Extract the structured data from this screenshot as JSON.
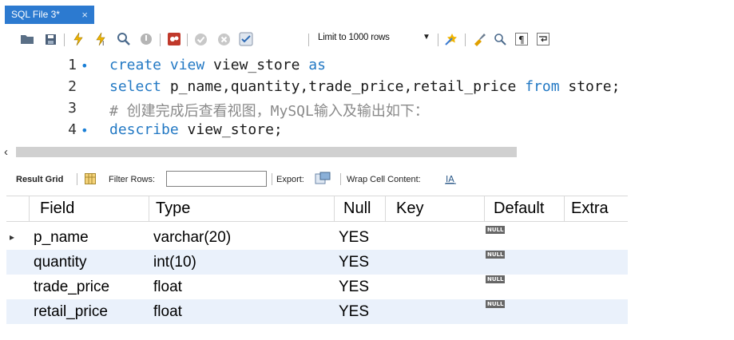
{
  "tab": {
    "title": "SQL File 3*",
    "close": "×"
  },
  "toolbar": {
    "limit_label": "Limit to 1000 rows",
    "icons": [
      "folder-icon",
      "save-icon",
      "execute-icon",
      "execute-current-icon",
      "explain-icon",
      "stop-icon",
      "toggle-error-icon",
      "commit-icon",
      "rollback-icon",
      "autocommit-icon",
      "beautify-icon",
      "find-icon",
      "invisible-chars-icon",
      "wrap-icon"
    ]
  },
  "editor": {
    "lines": [
      {
        "num": "1",
        "dot": "•"
      },
      {
        "num": "2",
        "dot": ""
      },
      {
        "num": "3",
        "dot": ""
      },
      {
        "num": "4",
        "dot": "•"
      }
    ],
    "line1": {
      "kw1": "create view",
      "id1": " view_store ",
      "kw2": "as"
    },
    "line2": {
      "kw1": "select",
      "id1": " p_name,quantity,trade_price,retail_price ",
      "kw2": "from",
      "id2": " store;"
    },
    "line3": {
      "comment": "# 创建完成后查看视图，MySQL输入及输出如下："
    },
    "line4": {
      "kw1": "describe",
      "id1": " view_store;"
    }
  },
  "scroll": {
    "left_arrow": "‹"
  },
  "result_toolbar": {
    "result_grid": "Result Grid",
    "filter_rows": "Filter Rows:",
    "export": "Export:",
    "wrap": "Wrap Cell Content:"
  },
  "grid": {
    "headers": [
      "Field",
      "Type",
      "Null",
      "Key",
      "Default",
      "Extra"
    ],
    "rows": [
      {
        "field": "p_name",
        "type": "varchar(20)",
        "null": "YES",
        "key": "",
        "default": "NULL",
        "extra": ""
      },
      {
        "field": "quantity",
        "type": "int(10)",
        "null": "YES",
        "key": "",
        "default": "NULL",
        "extra": ""
      },
      {
        "field": "trade_price",
        "type": "float",
        "null": "YES",
        "key": "",
        "default": "NULL",
        "extra": ""
      },
      {
        "field": "retail_price",
        "type": "float",
        "null": "YES",
        "key": "",
        "default": "NULL",
        "extra": ""
      }
    ],
    "row_marker": "▸",
    "colors": {
      "stripe": "#eaf1fb",
      "white": "#ffffff",
      "header_line": "#d9d9d9"
    }
  }
}
